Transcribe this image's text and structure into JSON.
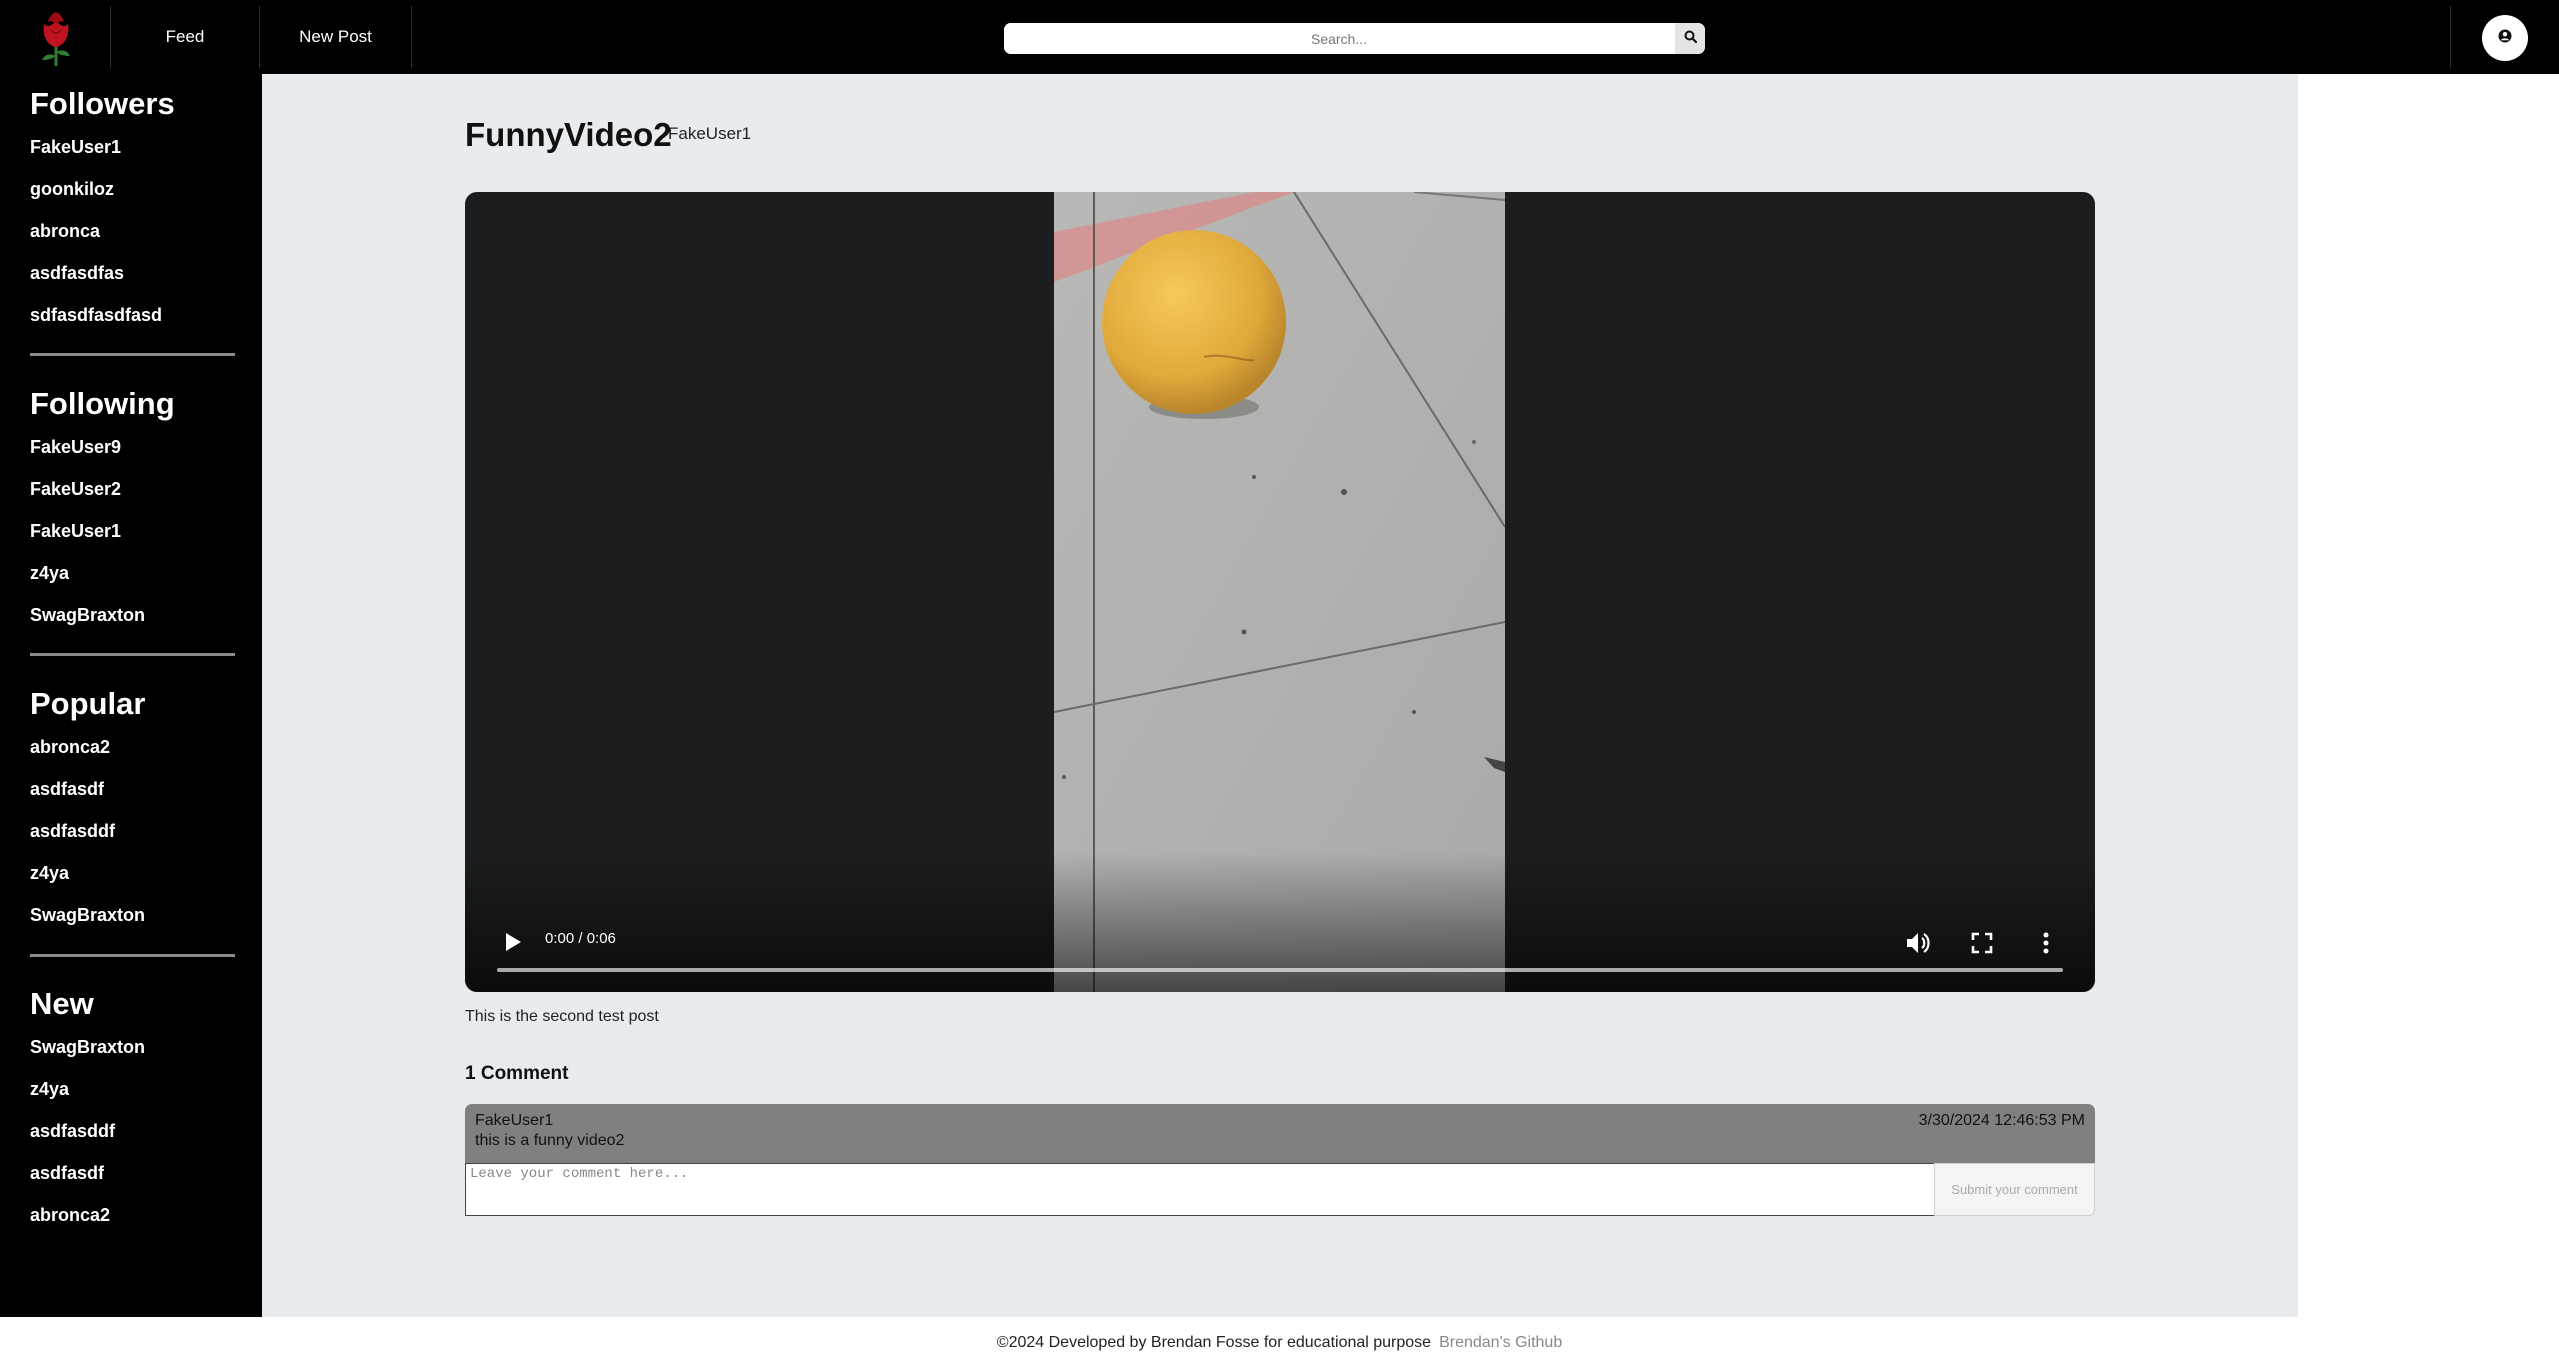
{
  "nav": {
    "feed_label": "Feed",
    "new_post_label": "New Post",
    "search_placeholder": "Search..."
  },
  "icons": {
    "logo": "rose-logo-icon",
    "search": "search-icon",
    "profile": "user-circle-icon",
    "play": "play-icon",
    "volume": "volume-icon",
    "fullscreen": "fullscreen-icon",
    "more": "more-options-icon"
  },
  "colors": {
    "topbar": "#000000",
    "sidebar": "#000000",
    "main_bg": "#e9ecef",
    "comment_card": "#808080",
    "rose": "#c1121f"
  },
  "sidebar": {
    "followers": {
      "title": "Followers",
      "items": [
        "FakeUser1",
        "goonkiloz",
        "abronca",
        "asdfasdfas",
        "sdfasdfasdfasd"
      ]
    },
    "following": {
      "title": "Following",
      "items": [
        "FakeUser9",
        "FakeUser2",
        "FakeUser1",
        "z4ya",
        "SwagBraxton"
      ]
    },
    "popular": {
      "title": "Popular",
      "items": [
        "abronca2",
        "asdfasdf",
        "asdfasddf",
        "z4ya",
        "SwagBraxton"
      ]
    },
    "new": {
      "title": "New",
      "items": [
        "SwagBraxton",
        "z4ya",
        "asdfasddf",
        "asdfasdf",
        "abronca2"
      ]
    }
  },
  "post": {
    "title": "FunnyVideo2",
    "author": "FakeUser1",
    "description": "This is the second test post",
    "video": {
      "time": "0:00 / 0:06",
      "progress": 0
    }
  },
  "comments": {
    "count_label": "1 Comment",
    "items": [
      {
        "author": "FakeUser1",
        "text": "this is a funny video2",
        "date": "3/30/2024 12:46:53 PM"
      }
    ],
    "input_placeholder": "Leave your comment here...",
    "submit_label": "Submit your comment"
  },
  "footer": {
    "text": "©2024 Developed by Brendan Fosse for educational purpose",
    "link_label": "Brendan's Github"
  }
}
